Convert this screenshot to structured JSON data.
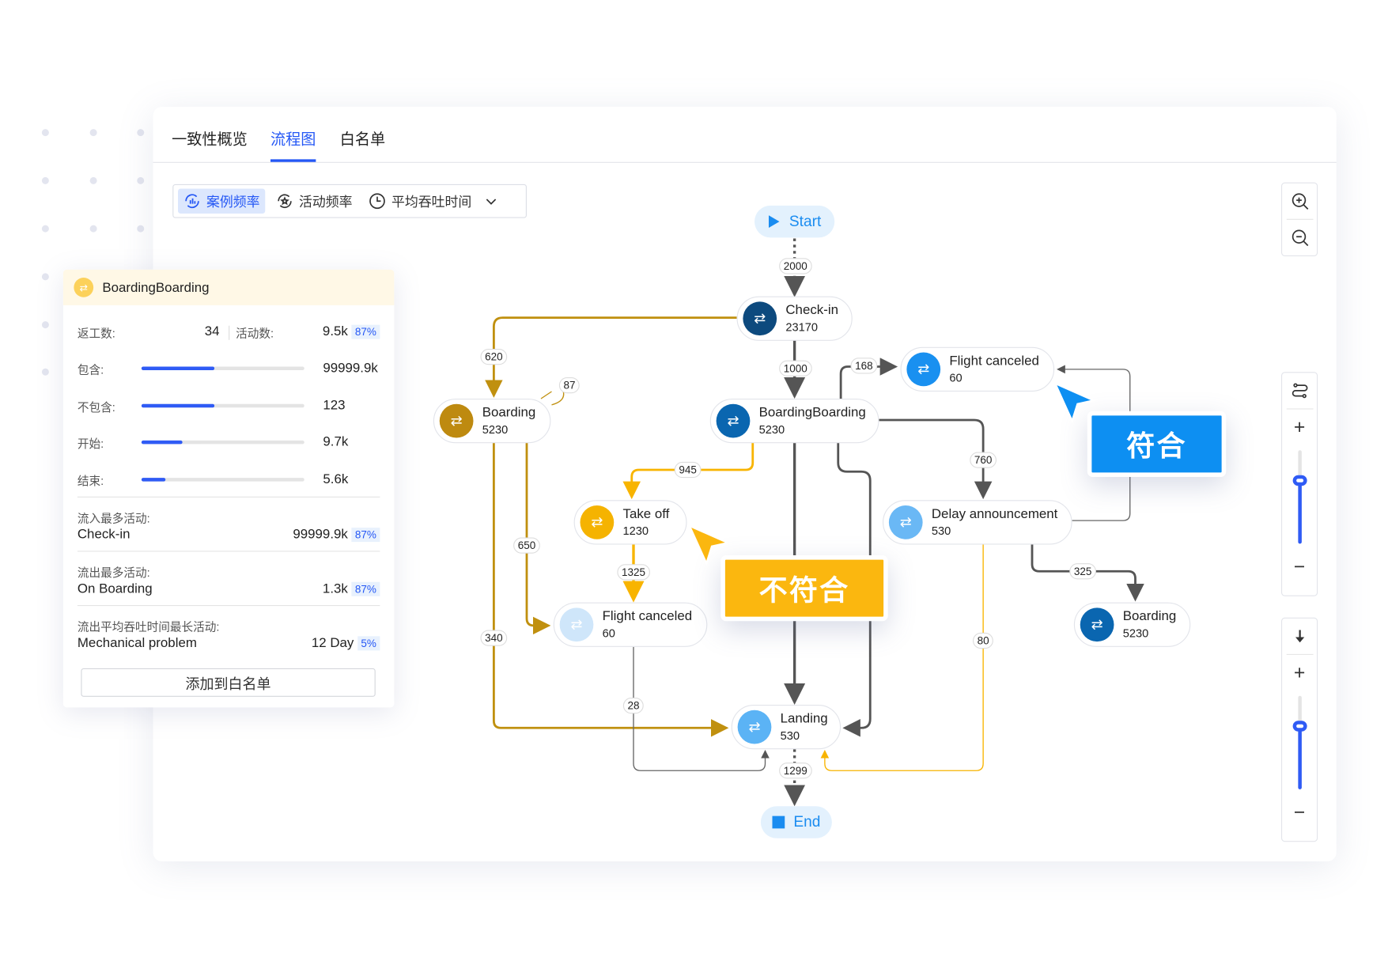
{
  "tabs": [
    {
      "label": "一致性概览"
    },
    {
      "label": "流程图",
      "active": true
    },
    {
      "label": "白名单"
    }
  ],
  "toolbar": {
    "items": [
      {
        "label": "案例频率",
        "icon": "chart-icon",
        "active": true
      },
      {
        "label": "活动频率",
        "icon": "refresh-star-icon"
      },
      {
        "label": "平均吞吐时间",
        "icon": "clock-icon"
      }
    ],
    "dropdown_icon": "chevron-down-icon"
  },
  "panel": {
    "title": "BoardingBoarding",
    "rework_label": "返工数:",
    "rework_value": "34",
    "activity_label": "活动数:",
    "activity_value": "9.5k",
    "activity_pct": "87%",
    "bars": [
      {
        "label": "包含:",
        "value": "99999.9k",
        "fraction": 0.45
      },
      {
        "label": "不包含:",
        "value": "123",
        "fraction": 0.45
      },
      {
        "label": "开始:",
        "value": "9.7k",
        "fraction": 0.25
      },
      {
        "label": "结束:",
        "value": "5.6k",
        "fraction": 0.15
      }
    ],
    "sections": [
      {
        "label": "流入最多活动:",
        "name": "Check-in",
        "value": "99999.9k",
        "pct": "87%"
      },
      {
        "label": "流出最多活动:",
        "name": "On Boarding",
        "value": "1.3k",
        "pct": "87%"
      },
      {
        "label": "流出平均吞吐时间最长活动:",
        "name": "Mechanical problem",
        "value": "12 Day",
        "pct": "5%"
      }
    ],
    "add_button": "添加到白名单"
  },
  "graph": {
    "start": "Start",
    "end": "End",
    "nodes": [
      {
        "name": "Check-in",
        "count": "23170",
        "color": "#0d4a7e"
      },
      {
        "name": "Boarding",
        "count": "5230",
        "color": "#be8a10"
      },
      {
        "name": "BoardingBoarding",
        "count": "5230",
        "color": "#0a66b0"
      },
      {
        "name": "Flight canceled",
        "count": "60",
        "color": "#1990f0"
      },
      {
        "name": "Take off",
        "count": "1230",
        "color": "#f5b301"
      },
      {
        "name": "Delay announcement",
        "count": "530",
        "color": "#6ab8f5"
      },
      {
        "name": "Flight canceled",
        "count": "60",
        "color": "#cfe6fa"
      },
      {
        "name": "Boarding",
        "count": "5230",
        "color": "#0a66b0"
      },
      {
        "name": "Landing",
        "count": "530",
        "color": "#5bb3f5"
      }
    ],
    "edge_labels": [
      "2000",
      "620",
      "87",
      "1000",
      "168",
      "760",
      "945",
      "650",
      "340",
      "1325",
      "28",
      "80",
      "325",
      "1299"
    ]
  },
  "tags": {
    "nonconform": "不符合",
    "conform": "符合"
  },
  "colors": {
    "accent": "#2457f5",
    "gold": "#c0900f",
    "yellow": "#f8b400",
    "blue": "#1390f0",
    "gray": "#555555"
  }
}
